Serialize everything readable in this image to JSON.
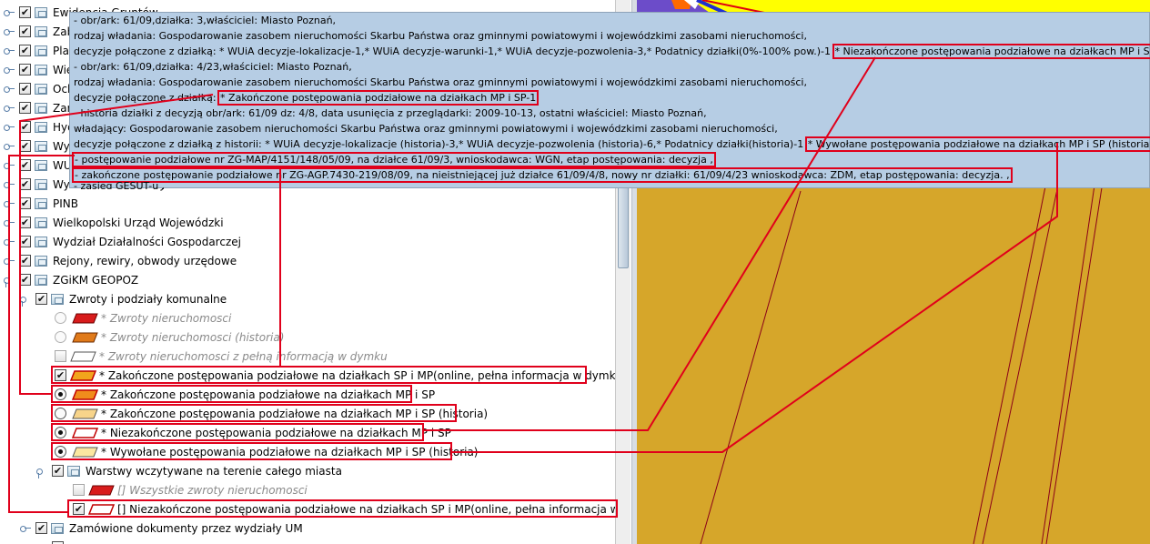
{
  "tree": {
    "items_top": [
      {
        "label": "Ewidencja Gruntów"
      },
      {
        "label": "Zab"
      },
      {
        "label": "Plan"
      },
      {
        "label": "Wiel"
      },
      {
        "label": "Ochr"
      },
      {
        "label": "Zarz"
      },
      {
        "label": "Hyd"
      },
      {
        "label": "Wyd"
      },
      {
        "label": "WUA"
      },
      {
        "label": "Wydział Architektury"
      }
    ],
    "items": [
      {
        "label": "PINB"
      },
      {
        "label": "Wielkopolski Urząd Wojewódzki"
      },
      {
        "label": "Wydział Działalności Gospodarczej"
      },
      {
        "label": "Rejony, rewiry, obwody urzędowe"
      },
      {
        "label": "ZGiKM GEOPOZ"
      },
      {
        "label": "Zwroty i podziały komunalne"
      },
      {
        "label": "* Zwroty nieruchomosci"
      },
      {
        "label": "* Zwroty nieruchomosci (historia)"
      },
      {
        "label": "* Zwroty nieruchomosci z pełną informacją w dymku"
      },
      {
        "label": "* Zakończone postępowania podziałowe na działkach SP i MP(online, pełna informacja w dymku)"
      },
      {
        "label": "* Zakończone postępowania podziałowe na działkach MP i SP"
      },
      {
        "label": "* Zakończone postępowania podziałowe na działkach MP i SP (historia)"
      },
      {
        "label": "* Niezakończone postępowania podziałowe na działkach MP i SP"
      },
      {
        "label": "* Wywołane postępowania podziałowe na działkach MP i SP (historia)"
      },
      {
        "label": "Warstwy wczytywane na terenie całego miasta"
      },
      {
        "label": "[] Wszystkie zwroty nieruchomosci"
      },
      {
        "label": "[] Niezakończone postępowania podziałowe na działkach SP i MP(online, pełna informacja w dymku)"
      },
      {
        "label": "Zamówione dokumenty przez wydziały UM"
      }
    ]
  },
  "tooltip": {
    "lines": [
      "- obr/ark: 61/09,działka: 3,właściciel: Miasto Poznań,",
      "rodzaj władania: Gospodarowanie zasobem nieruchomości Skarbu Państwa oraz gminnymi powiatowymi i wojewódzkimi zasobami nieruchomości,",
      "decyzje połączone z działką: * WUiA decyzje-lokalizacje-1,* WUiA decyzje-warunki-1,* WUiA decyzje-pozwolenia-3,* Podatnicy działki(0%-100% pow.)-1",
      "- obr/ark: 61/09,działka: 4/23,właściciel: Miasto Poznań,",
      "rodzaj władania: Gospodarowanie zasobem nieruchomości Skarbu Państwa oraz gminnymi powiatowymi i wojewódzkimi zasobami nieruchomości,",
      "decyzje połączone z działką:",
      "- historia działki z decyzją obr/ark: 61/09 dz: 4/8, data usunięcia z przeglądarki: 2009-10-13, ostatni właściciel: Miasto Poznań,",
      "władający: Gospodarowanie zasobem nieruchomości Skarbu Państwa oraz gminnymi powiatowymi i wojewódzkimi zasobami nieruchomości,",
      "decyzje połączone z działką z historii: * WUiA decyzje-lokalizacje (historia)-3,* WUiA decyzje-pozwolenia (historia)-6,* Podatnicy działki(historia)-1",
      "- postępowanie podziałowe nr ZG-MAP/4151/148/05/09, na działce 61/09/3, wnioskodawca: WGN, etap postępowania: decyzja ,",
      "- zakończone postępowanie podziałowe nr ZG-AGP.7430-219/08/09, na nieistniejącej już działce 61/09/4/8, nowy nr działki: 61/09/4/23 wnioskodawca: ZDM, etap postępowania: decyzja. ,",
      "- zasięg GESUT-u ,"
    ],
    "highlight_1": "* Niezakończone postępowania podziałowe na działkach MP i SP-2",
    "highlight_2": "* Zakończone postępowania podziałowe na działkach MP i SP-1",
    "highlight_3": "* Wywołane postępowania podziałowe na działkach MP i SP (historia)-3"
  },
  "colors": {
    "tooltip_bg": "#b6cde4",
    "highlight": "#e0001b",
    "map_fill": "#d6a62a",
    "map_yellow": "#ffff00"
  }
}
